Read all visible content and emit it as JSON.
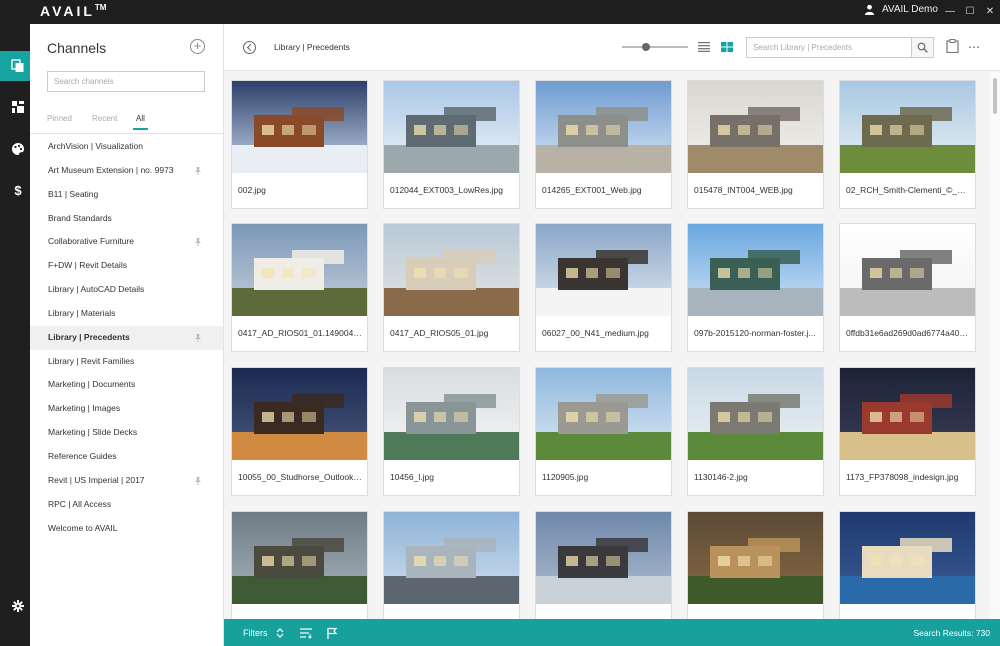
{
  "app": {
    "brand": "AVAIL",
    "trademark": "TM",
    "user": "AVAIL Demo"
  },
  "window": {
    "minimize": "—",
    "maximize": "☐",
    "close": "✕"
  },
  "rail": {
    "items": [
      "files-icon",
      "dashboard-icon",
      "palette-icon",
      "dollar-icon"
    ],
    "bottom": "settings-icon"
  },
  "channels": {
    "title": "Channels",
    "add_label": "+",
    "search_placeholder": "Search channels",
    "tabs": [
      "Pinned",
      "Recent",
      "All"
    ],
    "active_tab": "All",
    "items": [
      {
        "label": "ArchVision | Visualization",
        "pinned": false
      },
      {
        "label": "Art Museum Extension | no. 9973",
        "pinned": true
      },
      {
        "label": "B11 | Seating",
        "pinned": false
      },
      {
        "label": "Brand Standards",
        "pinned": false
      },
      {
        "label": "Collaborative Furniture",
        "pinned": true
      },
      {
        "label": "F+DW | Revit Details",
        "pinned": false
      },
      {
        "label": "Library | AutoCAD Details",
        "pinned": false
      },
      {
        "label": "Library | Materials",
        "pinned": false
      },
      {
        "label": "Library | Precedents",
        "pinned": true,
        "selected": true
      },
      {
        "label": "Library | Revit Families",
        "pinned": false
      },
      {
        "label": "Marketing | Documents",
        "pinned": false
      },
      {
        "label": "Marketing | Images",
        "pinned": false
      },
      {
        "label": "Marketing | Slide Decks",
        "pinned": false
      },
      {
        "label": "Reference Guides",
        "pinned": false
      },
      {
        "label": "Revit | US Imperial | 2017",
        "pinned": true
      },
      {
        "label": "RPC | All Access",
        "pinned": false
      },
      {
        "label": "Welcome to AVAIL",
        "pinned": false
      }
    ]
  },
  "toolbar": {
    "breadcrumb": "Library | Precedents",
    "thumbnail_size": 0.3,
    "search_placeholder": "Search Library | Precedents",
    "view": "grid"
  },
  "grid": {
    "items": [
      "002.jpg",
      "012044_EXT003_LowRes.jpg",
      "014265_EXT001_Web.jpg",
      "015478_INT004_WEB.jpg",
      "02_RCH_Smith-Clementi_©_Un...",
      "0417_AD_RIOS01_01.14900492...",
      "0417_AD_RIOS05_01.jpg",
      "06027_00_N41_medium.jpg",
      "097b-2015120-norman-foster.j...",
      "0ffdb31e6ad269d0ad6774a407...",
      "10055_00_Studhorse_Outlook_...",
      "10456_l.jpg",
      "1120905.jpg",
      "1130146-2.jpg",
      "1173_FP378098_indesign.jpg",
      "",
      "",
      "",
      "",
      ""
    ]
  },
  "footer": {
    "filters": "Filters",
    "results": "Search Results: 730"
  },
  "colors": {
    "accent": "#17a39f",
    "titlebar": "#1e1e1e",
    "rail": "#1f1f1f"
  }
}
